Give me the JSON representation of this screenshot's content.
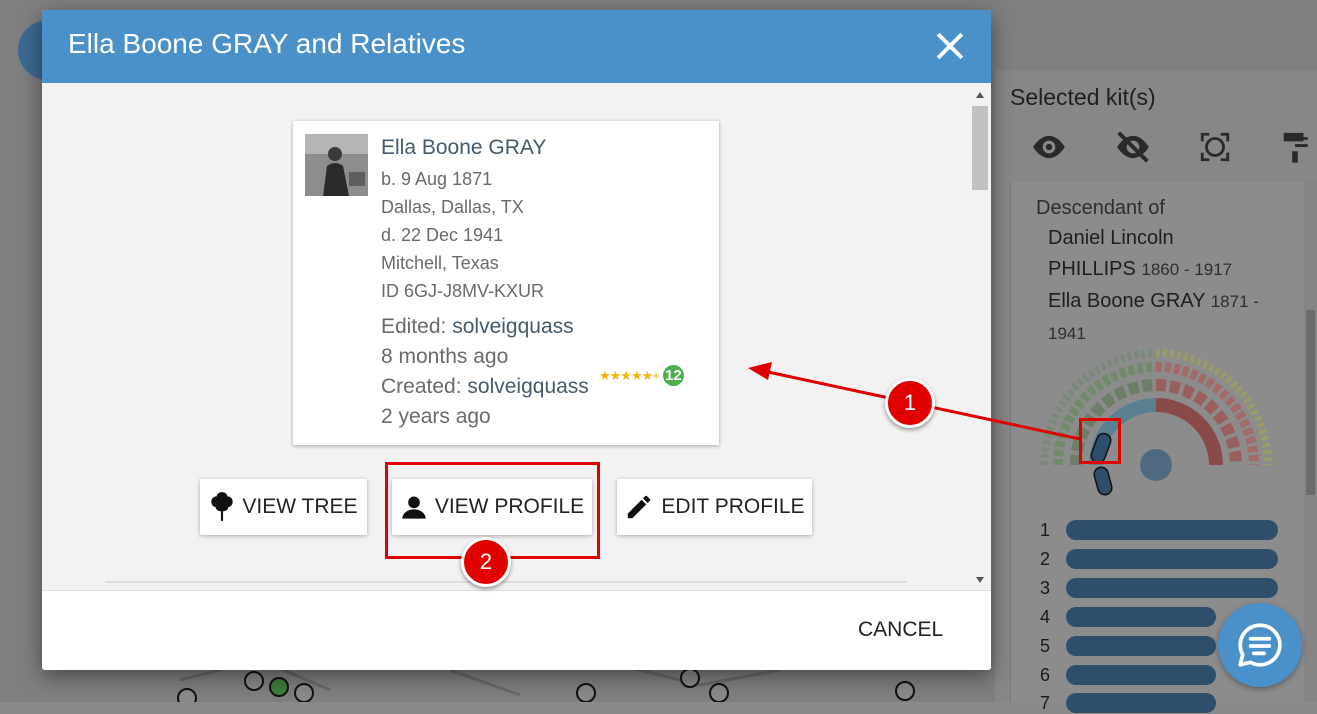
{
  "background_panel": {
    "title": "Selected kit(s)",
    "icons": [
      "eye-icon",
      "eye-off-icon",
      "focus-frame-icon",
      "paint-roller-icon"
    ],
    "descendant_label": "Descendant of",
    "ancestors": [
      {
        "name": "Daniel Lincoln",
        "name2": "PHILLIPS",
        "years": "1860 - 1917"
      },
      {
        "name": "Ella Boone GRAY",
        "years": "1871 -",
        "years2": "1941"
      }
    ],
    "chromosomes": [
      "1",
      "2",
      "3",
      "4",
      "5",
      "6",
      "7"
    ]
  },
  "dialog": {
    "title": "Ella Boone GRAY and Relatives",
    "close_icon": "close-icon",
    "person": {
      "name": "Ella Boone GRAY",
      "birth": "b. 9 Aug 1871",
      "birth_place": "Dallas, Dallas, TX",
      "death": "d. 22 Dec 1941",
      "death_place": "Mitchell, Texas",
      "id": "ID 6GJ-J8MV-KXUR",
      "edited_label": "Edited:",
      "edited_user": "solveigquass",
      "edited_ago": "8 months ago",
      "created_label": "Created:",
      "created_user": "solveigquass",
      "created_ago": "2 years ago",
      "stars": "★★★★★",
      "stars_plus": "+",
      "badge": "12"
    },
    "buttons": {
      "view_tree": "VIEW TREE",
      "view_profile": "VIEW PROFILE",
      "edit_profile": "EDIT PROFILE"
    },
    "cancel": "CANCEL"
  },
  "annotations": {
    "marker1": "1",
    "marker2": "2",
    "color": "#e00000"
  },
  "colors": {
    "header": "#4a90c9",
    "chromosome": "#2f4e6c",
    "badge": "#4caf50",
    "stars": "#f5b400"
  }
}
